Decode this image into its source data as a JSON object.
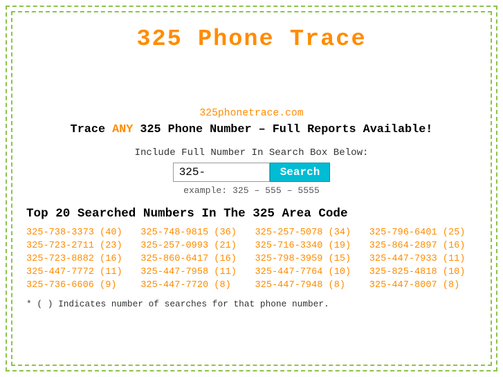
{
  "page": {
    "title": "325 Phone Trace",
    "site_url": "325phonetrace.com",
    "tagline_prefix": "Trace ",
    "tagline_any": "ANY",
    "tagline_suffix": " 325 Phone Number – Full Reports Available!",
    "search_label": "Include Full Number In Search Box Below:",
    "search_input_value": "325-",
    "search_button_label": "Search",
    "search_example": "example: 325 – 555 – 5555",
    "top_numbers_heading": "Top 20 Searched Numbers In The 325 Area Code",
    "footnote": "* ( ) Indicates number of searches for that phone number."
  },
  "numbers": [
    {
      "label": "325-738-3373 (40)",
      "col": 0
    },
    {
      "label": "325-748-9815 (36)",
      "col": 1
    },
    {
      "label": "325-257-5078 (34)",
      "col": 2
    },
    {
      "label": "325-796-6401 (25)",
      "col": 3
    },
    {
      "label": "325-723-2711 (23)",
      "col": 0
    },
    {
      "label": "325-257-0993 (21)",
      "col": 1
    },
    {
      "label": "325-716-3340 (19)",
      "col": 2
    },
    {
      "label": "325-864-2897 (16)",
      "col": 3
    },
    {
      "label": "325-723-8882 (16)",
      "col": 0
    },
    {
      "label": "325-860-6417 (16)",
      "col": 1
    },
    {
      "label": "325-798-3959 (15)",
      "col": 2
    },
    {
      "label": "325-447-7933 (11)",
      "col": 3
    },
    {
      "label": "325-447-7772 (11)",
      "col": 0
    },
    {
      "label": "325-447-7958 (11)",
      "col": 1
    },
    {
      "label": "325-447-7764 (10)",
      "col": 2
    },
    {
      "label": "325-825-4818 (10)",
      "col": 3
    },
    {
      "label": "325-736-6606 (9)",
      "col": 0
    },
    {
      "label": "325-447-7720 (8)",
      "col": 1
    },
    {
      "label": "325-447-7948 (8)",
      "col": 2
    },
    {
      "label": "325-447-8007 (8)",
      "col": 3
    }
  ]
}
